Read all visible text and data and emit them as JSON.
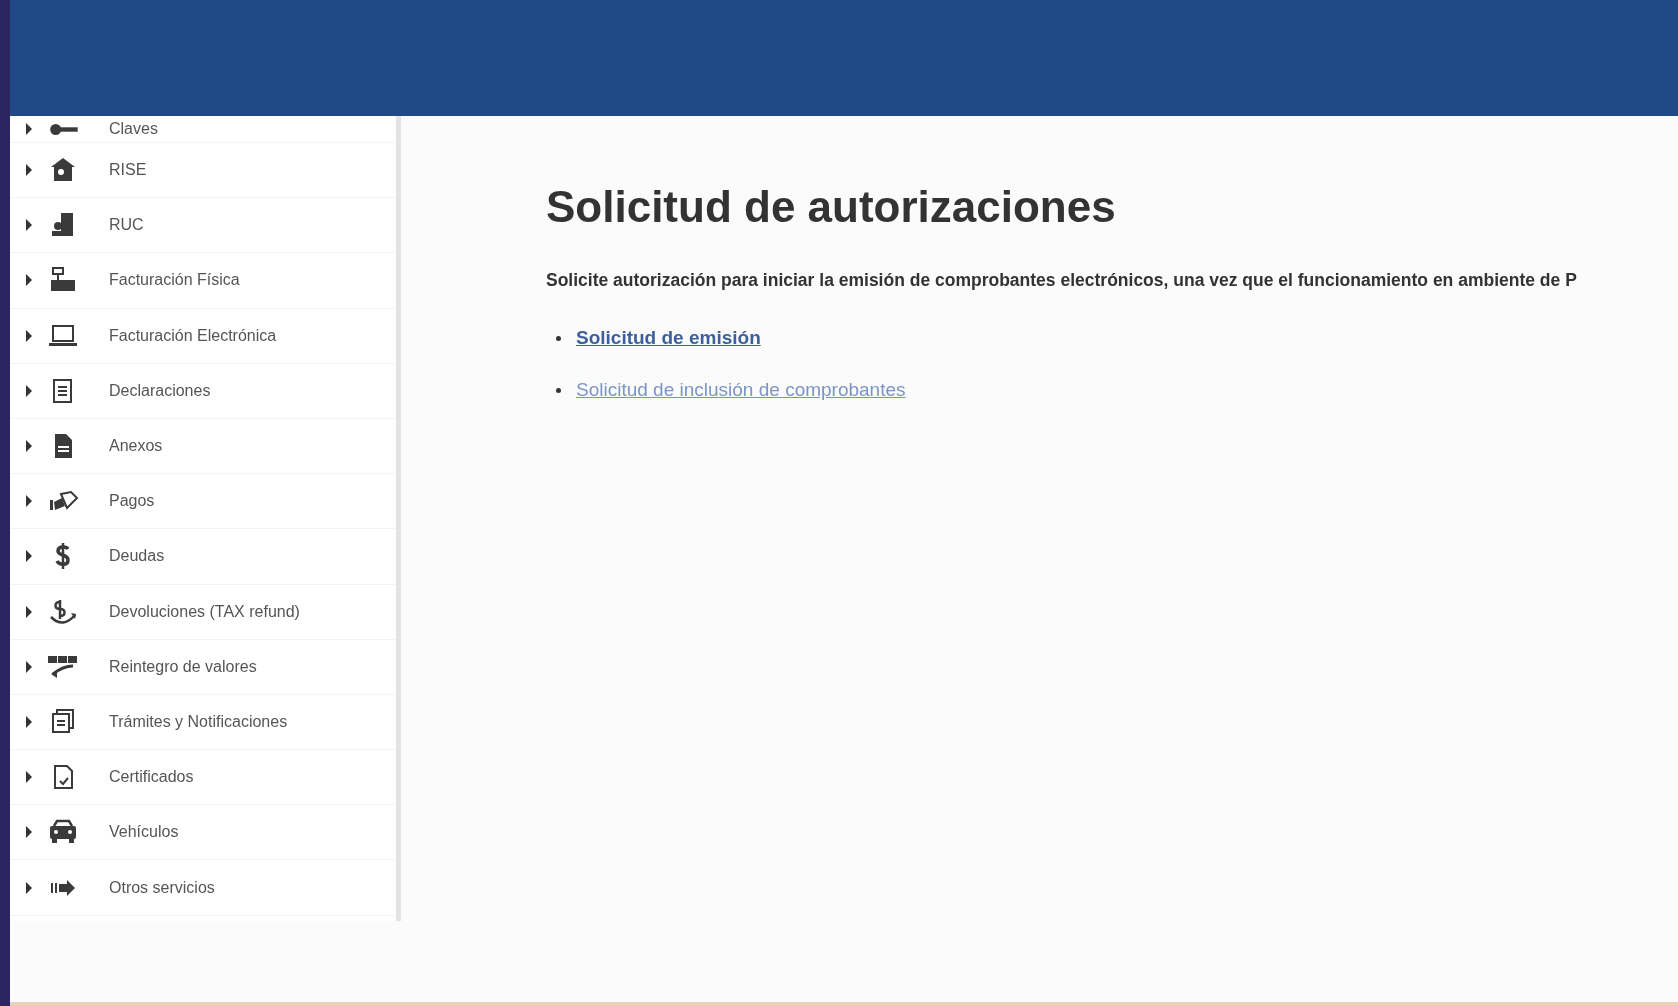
{
  "sidebar": {
    "items": [
      {
        "label": "Claves",
        "expanded": false
      },
      {
        "label": "RISE",
        "expanded": false
      },
      {
        "label": "RUC",
        "expanded": false
      },
      {
        "label": "Facturación Física",
        "expanded": false
      },
      {
        "label": "Facturación Electrónica",
        "expanded": false
      },
      {
        "label": "Declaraciones",
        "expanded": false
      },
      {
        "label": "Anexos",
        "expanded": false
      },
      {
        "label": "Pagos",
        "expanded": false
      },
      {
        "label": "Deudas",
        "expanded": false
      },
      {
        "label": "Devoluciones (TAX refund)",
        "expanded": false
      },
      {
        "label": "Reintegro de valores",
        "expanded": false
      },
      {
        "label": "Trámites y Notificaciones",
        "expanded": false
      },
      {
        "label": "Certificados",
        "expanded": false
      },
      {
        "label": "Vehículos",
        "expanded": false
      },
      {
        "label": "Otros servicios",
        "expanded": false
      }
    ]
  },
  "content": {
    "title": "Solicitud de autorizaciones",
    "description": "Solicite autorización para iniciar la emisión de comprobantes electrónicos, una vez que el funcionamiento en ambiente de P",
    "links": [
      {
        "label": "Solicitud de emisión",
        "hovered": true
      },
      {
        "label": "Solicitud de inclusión de comprobantes",
        "hovered": false
      }
    ]
  }
}
